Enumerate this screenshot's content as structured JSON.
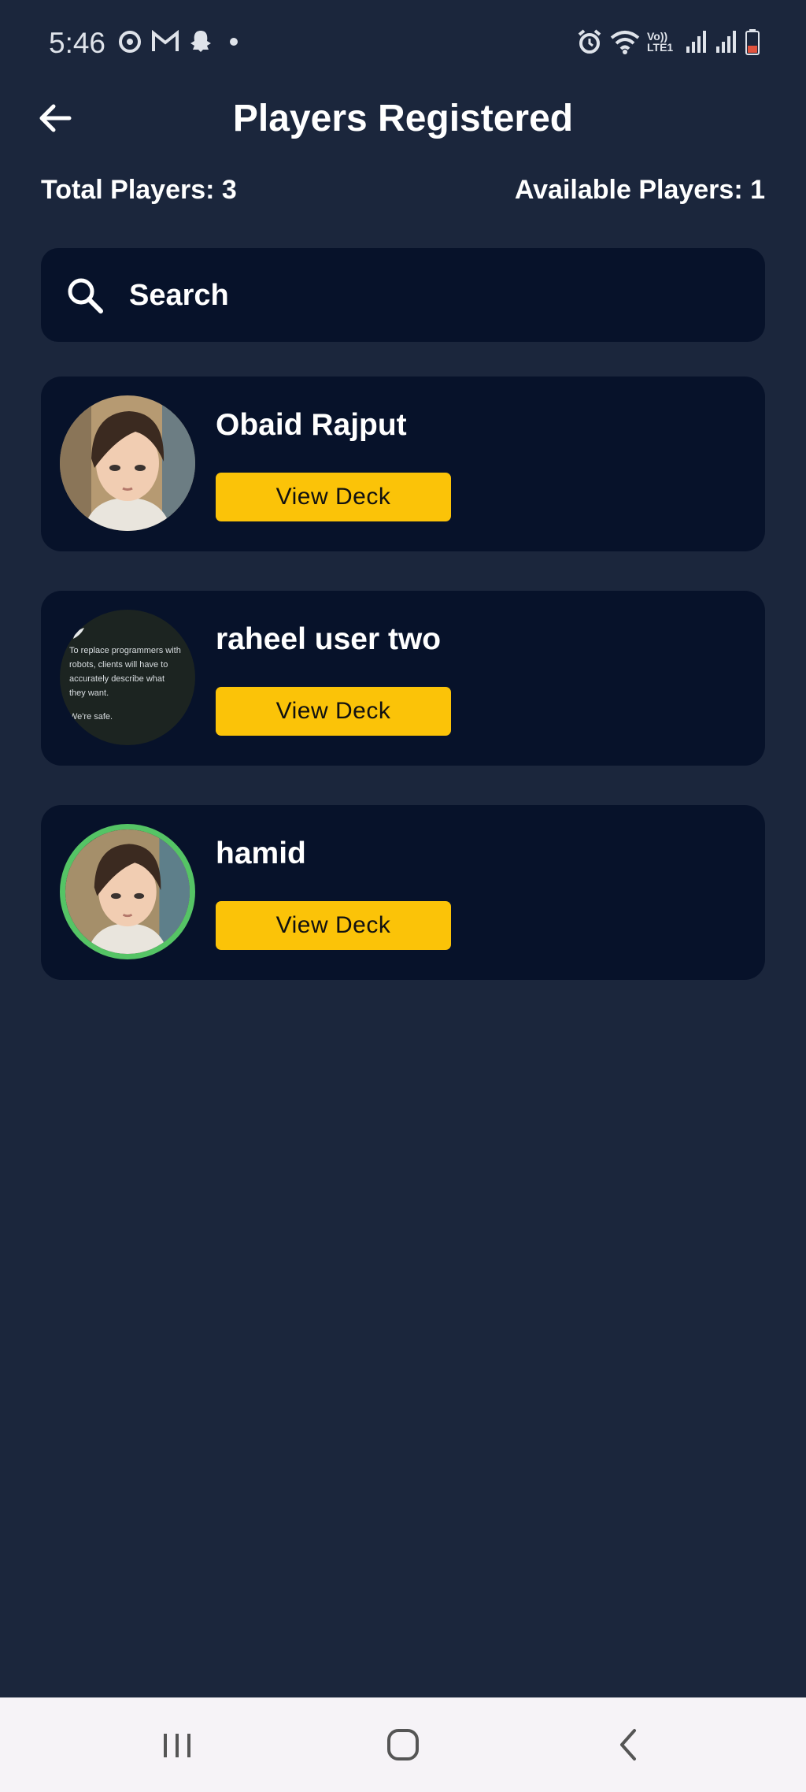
{
  "status_bar": {
    "time": "5:46",
    "left_icons": [
      "sync-icon",
      "gmail-icon",
      "snapchat-icon",
      "dot-icon"
    ],
    "right_icons": [
      "alarm-icon",
      "wifi-icon",
      "volte-icon",
      "signal-icon",
      "signal-icon",
      "battery-icon"
    ],
    "volte_label": "Vo)) LTE1"
  },
  "header": {
    "title": "Players Registered",
    "back_icon": "arrow-left-icon"
  },
  "stats": {
    "total_players": "Total Players: 3",
    "available_players": "Available Players: 1"
  },
  "search": {
    "placeholder": "Search",
    "value": "",
    "icon": "search-icon"
  },
  "players": [
    {
      "name": "Obaid Rajput",
      "button_label": "View Deck",
      "online": false
    },
    {
      "name": "raheel user two",
      "button_label": "View Deck",
      "online": false,
      "avatar_text": [
        "To replace programmers with",
        "robots, clients will have to",
        "accurately describe what",
        "they want.",
        "We're safe."
      ]
    },
    {
      "name": "hamid",
      "button_label": "View Deck",
      "online": true
    }
  ],
  "colors": {
    "background": "#1b263c",
    "card": "#07122a",
    "accent": "#fbc308",
    "online_ring": "#55c465"
  },
  "nav_bar": {
    "buttons": [
      "recent-apps-icon",
      "home-icon",
      "back-icon"
    ]
  }
}
